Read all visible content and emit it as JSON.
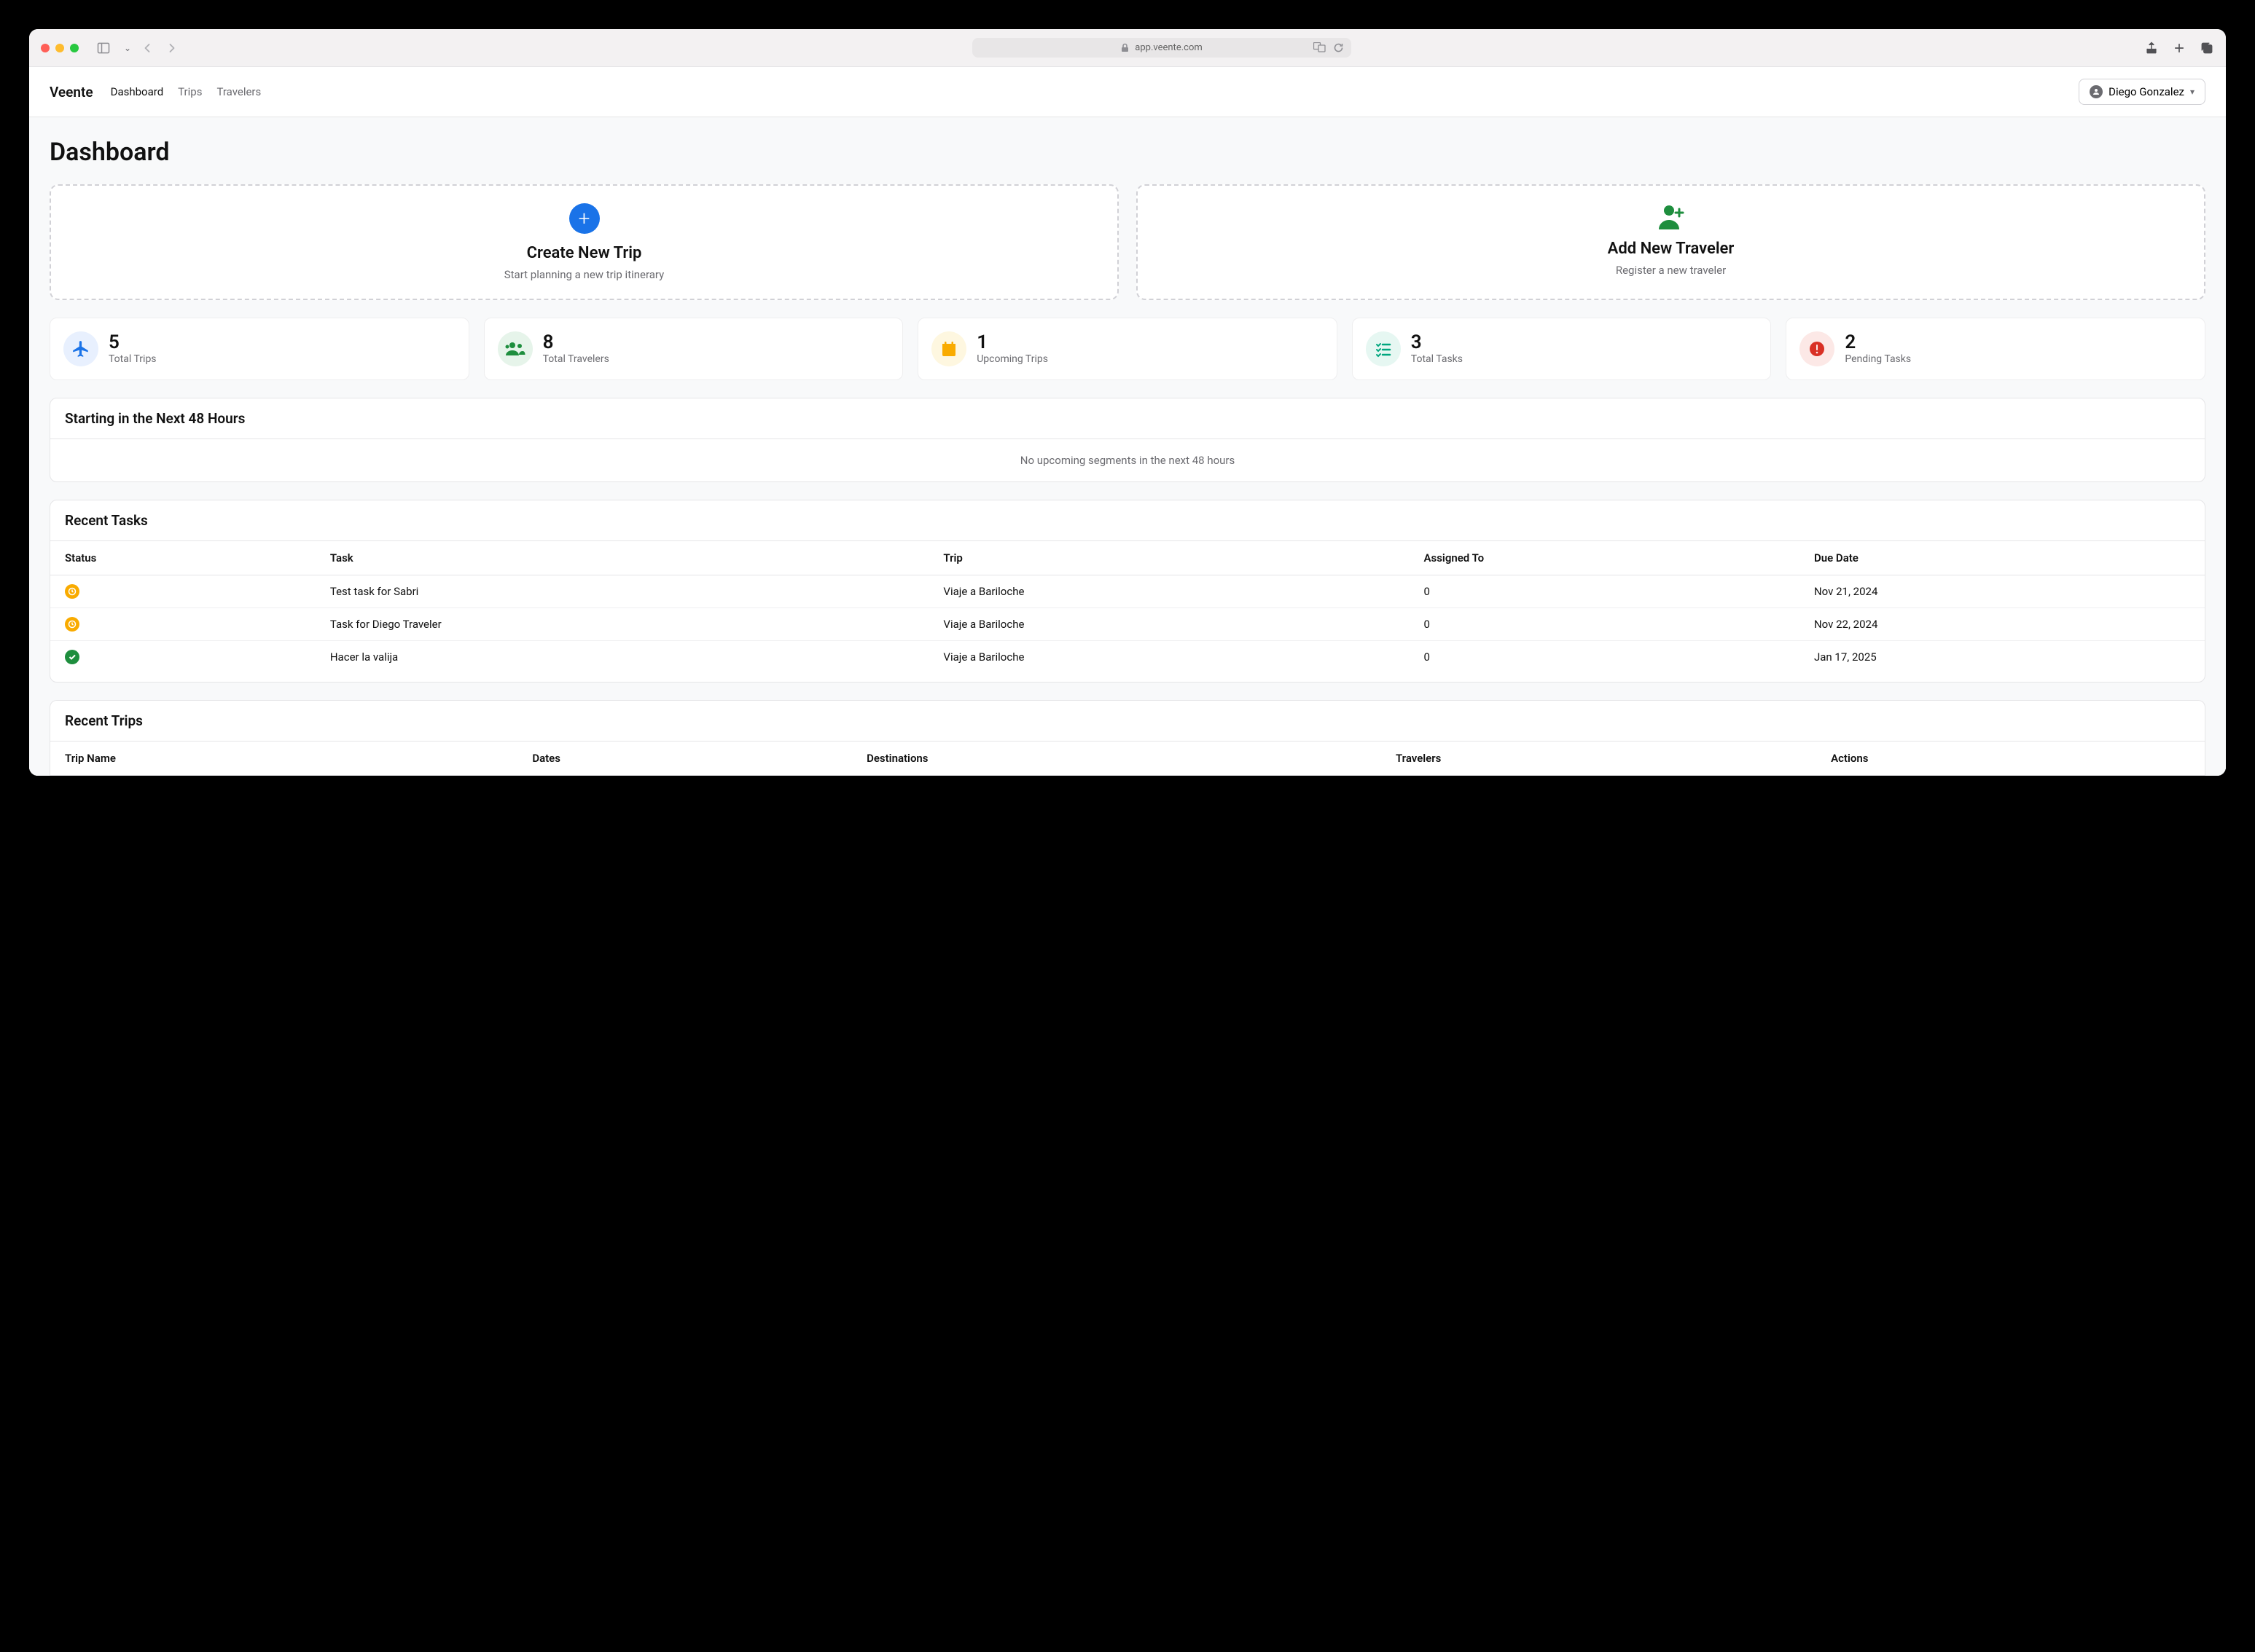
{
  "browser": {
    "url": "app.veente.com"
  },
  "nav": {
    "brand": "Veente",
    "links": [
      "Dashboard",
      "Trips",
      "Travelers"
    ],
    "user": "Diego Gonzalez"
  },
  "page": {
    "title": "Dashboard"
  },
  "actions": {
    "create_trip": {
      "title": "Create New Trip",
      "subtitle": "Start planning a new trip itinerary"
    },
    "add_traveler": {
      "title": "Add New Traveler",
      "subtitle": "Register a new traveler"
    }
  },
  "stats": [
    {
      "value": "5",
      "label": "Total Trips",
      "icon": "plane",
      "color": "blue"
    },
    {
      "value": "8",
      "label": "Total Travelers",
      "icon": "people",
      "color": "green"
    },
    {
      "value": "1",
      "label": "Upcoming Trips",
      "icon": "calendar",
      "color": "yellow"
    },
    {
      "value": "3",
      "label": "Total Tasks",
      "icon": "list",
      "color": "teal"
    },
    {
      "value": "2",
      "label": "Pending Tasks",
      "icon": "alert",
      "color": "red"
    }
  ],
  "next48": {
    "title": "Starting in the Next 48 Hours",
    "empty": "No upcoming segments in the next 48 hours"
  },
  "recent_tasks": {
    "title": "Recent Tasks",
    "columns": [
      "Status",
      "Task",
      "Trip",
      "Assigned To",
      "Due Date"
    ],
    "rows": [
      {
        "status": "pending",
        "task": "Test task for Sabri",
        "trip": "Viaje a Bariloche",
        "assigned": "0",
        "due": "Nov 21, 2024"
      },
      {
        "status": "pending",
        "task": "Task for Diego Traveler",
        "trip": "Viaje a Bariloche",
        "assigned": "0",
        "due": "Nov 22, 2024"
      },
      {
        "status": "done",
        "task": "Hacer la valija",
        "trip": "Viaje a Bariloche",
        "assigned": "0",
        "due": "Jan 17, 2025"
      }
    ]
  },
  "recent_trips": {
    "title": "Recent Trips",
    "columns": [
      "Trip Name",
      "Dates",
      "Destinations",
      "Travelers",
      "Actions"
    ]
  }
}
